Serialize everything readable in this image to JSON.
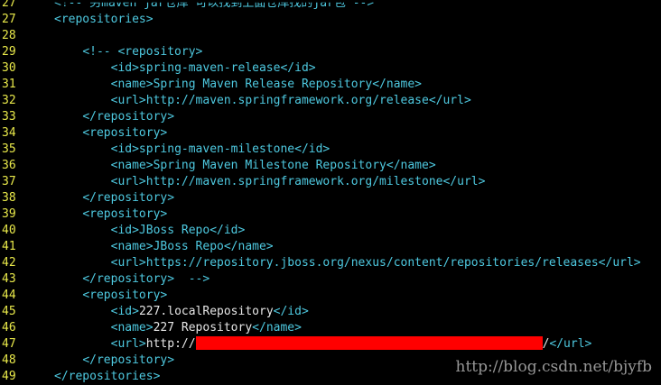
{
  "editor": {
    "lines": [
      {
        "num": "27",
        "indent": "",
        "html": "<span class='partial'>&lt;!-- 另maven jar仓库 可以找到上面仓库找的jar包 --&gt;</span>"
      },
      {
        "num": "27",
        "indent": "",
        "html": "<span class='t'>&lt;repositories&gt;</span>"
      },
      {
        "num": "28",
        "indent": "",
        "html": ""
      },
      {
        "num": "29",
        "indent": "    ",
        "html": "<span class='t'>&lt;!-- &lt;repository&gt;</span>"
      },
      {
        "num": "30",
        "indent": "        ",
        "html": "<span class='t'>&lt;id&gt;spring-maven-release&lt;/id&gt;</span>"
      },
      {
        "num": "31",
        "indent": "        ",
        "html": "<span class='t'>&lt;name&gt;Spring Maven Release Repository&lt;/name&gt;</span>"
      },
      {
        "num": "32",
        "indent": "        ",
        "html": "<span class='t'>&lt;url&gt;http://maven.springframework.org/release&lt;/url&gt;</span>"
      },
      {
        "num": "33",
        "indent": "    ",
        "html": "<span class='t'>&lt;/repository&gt;</span>"
      },
      {
        "num": "34",
        "indent": "    ",
        "html": "<span class='t'>&lt;repository&gt;</span>"
      },
      {
        "num": "35",
        "indent": "        ",
        "html": "<span class='t'>&lt;id&gt;spring-maven-milestone&lt;/id&gt;</span>"
      },
      {
        "num": "36",
        "indent": "        ",
        "html": "<span class='t'>&lt;name&gt;Spring Maven Milestone Repository&lt;/name&gt;</span>"
      },
      {
        "num": "37",
        "indent": "        ",
        "html": "<span class='t'>&lt;url&gt;http://maven.springframework.org/milestone&lt;/url&gt;</span>"
      },
      {
        "num": "38",
        "indent": "    ",
        "html": "<span class='t'>&lt;/repository&gt;</span>"
      },
      {
        "num": "39",
        "indent": "    ",
        "html": "<span class='t'>&lt;repository&gt;</span>"
      },
      {
        "num": "40",
        "indent": "        ",
        "html": "<span class='t'>&lt;id&gt;JBoss Repo&lt;/id&gt;</span>"
      },
      {
        "num": "41",
        "indent": "        ",
        "html": "<span class='t'>&lt;name&gt;JBoss Repo&lt;/name&gt;</span>"
      },
      {
        "num": "42",
        "indent": "        ",
        "html": "<span class='t'>&lt;url&gt;https://repository.jboss.org/nexus/content/repositories/releases&lt;/url&gt;</span>"
      },
      {
        "num": "43",
        "indent": "    ",
        "html": "<span class='t'>&lt;/repository&gt;  --&gt;</span>"
      },
      {
        "num": "44",
        "indent": "    ",
        "html": "<span class='t'>&lt;repository&gt;</span>"
      },
      {
        "num": "45",
        "indent": "        ",
        "html": "<span class='t'>&lt;id&gt;</span><span class='v'>227.localRepository</span><span class='t'>&lt;/id&gt;</span>"
      },
      {
        "num": "46",
        "indent": "        ",
        "html": "<span class='t'>&lt;name&gt;</span><span class='v'>227 Repository</span><span class='t'>&lt;/name&gt;</span>"
      },
      {
        "num": "47",
        "indent": "        ",
        "html": "<span class='t'>&lt;url&gt;</span><span class='v'>http://</span><span class='redact'></span><span class='v'>/</span><span class='t'>&lt;/url&gt;</span>"
      },
      {
        "num": "48",
        "indent": "    ",
        "html": "<span class='t'>&lt;/repository&gt;</span>"
      },
      {
        "num": "49",
        "indent": "",
        "html": "<span class='t'>&lt;/repositories&gt;</span>"
      }
    ]
  },
  "watermark": "http://blog.csdn.net/bjyfb",
  "colors": {
    "background": "#000000",
    "line_numbers": "#e8e84a",
    "tag_text": "#4ec9e0",
    "value_text": "#e6e6e6",
    "redaction": "#ff0000"
  }
}
